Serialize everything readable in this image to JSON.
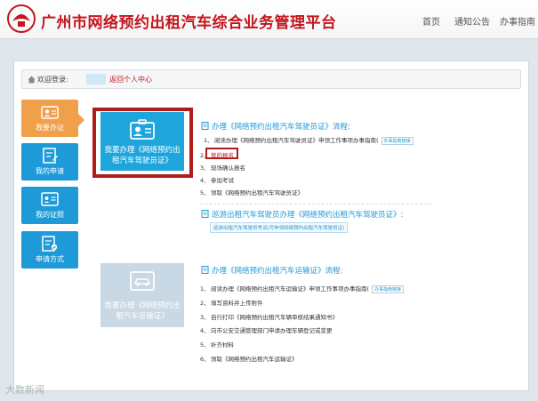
{
  "header": {
    "site_title": "广州市网络预约出租汽车综合业务管理平台",
    "nav": {
      "home": "首页",
      "notice": "通知公告",
      "guide": "办事指南"
    }
  },
  "welcome": {
    "label": "欢迎登录:",
    "back_link": "返回个人中心"
  },
  "sidebar": {
    "items": [
      {
        "label": "我要办证",
        "icon": "id-card-icon"
      },
      {
        "label": "我的申请",
        "icon": "form-edit-icon"
      },
      {
        "label": "我的证照",
        "icon": "certificate-icon"
      },
      {
        "label": "申请方式",
        "icon": "apply-method-icon"
      }
    ]
  },
  "cards": {
    "driver": {
      "title": "我要办理《网络预约出租汽车驾驶员证》"
    },
    "vehicle": {
      "title": "我要办理《网络预约出租汽车运输证》"
    }
  },
  "driver_process": {
    "title": "办理《网络预约出租汽车驾驶员证》流程:",
    "steps": [
      {
        "num": "1、",
        "text": "阅读办理《网络预约出租汽车驾驶员证》申领工作事项办事指南(",
        "tag": "办事指南链接"
      },
      {
        "num": "2、",
        "text": "我的报名"
      },
      {
        "num": "3、",
        "text": "现场确认报名"
      },
      {
        "num": "4、",
        "text": "参加考试"
      },
      {
        "num": "5、",
        "text": "领取《网络预约出租汽车驾驶员证》"
      }
    ],
    "extra_title": "巡游出租汽车驾驶员办理《网络预约出租汽车驾驶员证》:",
    "extra_link": "巡游出租汽车驾驶员考试(可申领网络预约出租汽车驾驶员证)"
  },
  "vehicle_process": {
    "title": "办理《网络预约出租汽车运输证》流程:",
    "steps": [
      {
        "num": "1、",
        "text": "阅读办理《网络预约出租汽车运输证》申领工作事项办事指南(",
        "tag": "办事指南链接"
      },
      {
        "num": "2、",
        "text": "填写资料并上传附件"
      },
      {
        "num": "3、",
        "text": "自行打印《网络预约出租汽车辆审核结果通知书》"
      },
      {
        "num": "4、",
        "text": "向市公安交通管理部门申请办理车辆登记或变更"
      },
      {
        "num": "5、",
        "text": "补齐材料"
      },
      {
        "num": "6、",
        "text": "领取《网络预约出租汽车运输证》"
      }
    ]
  },
  "watermark": "大数新闻",
  "colors": {
    "brand_red": "#c4161c",
    "accent_blue": "#1e9ad9",
    "active_orange": "#f0a04b"
  }
}
